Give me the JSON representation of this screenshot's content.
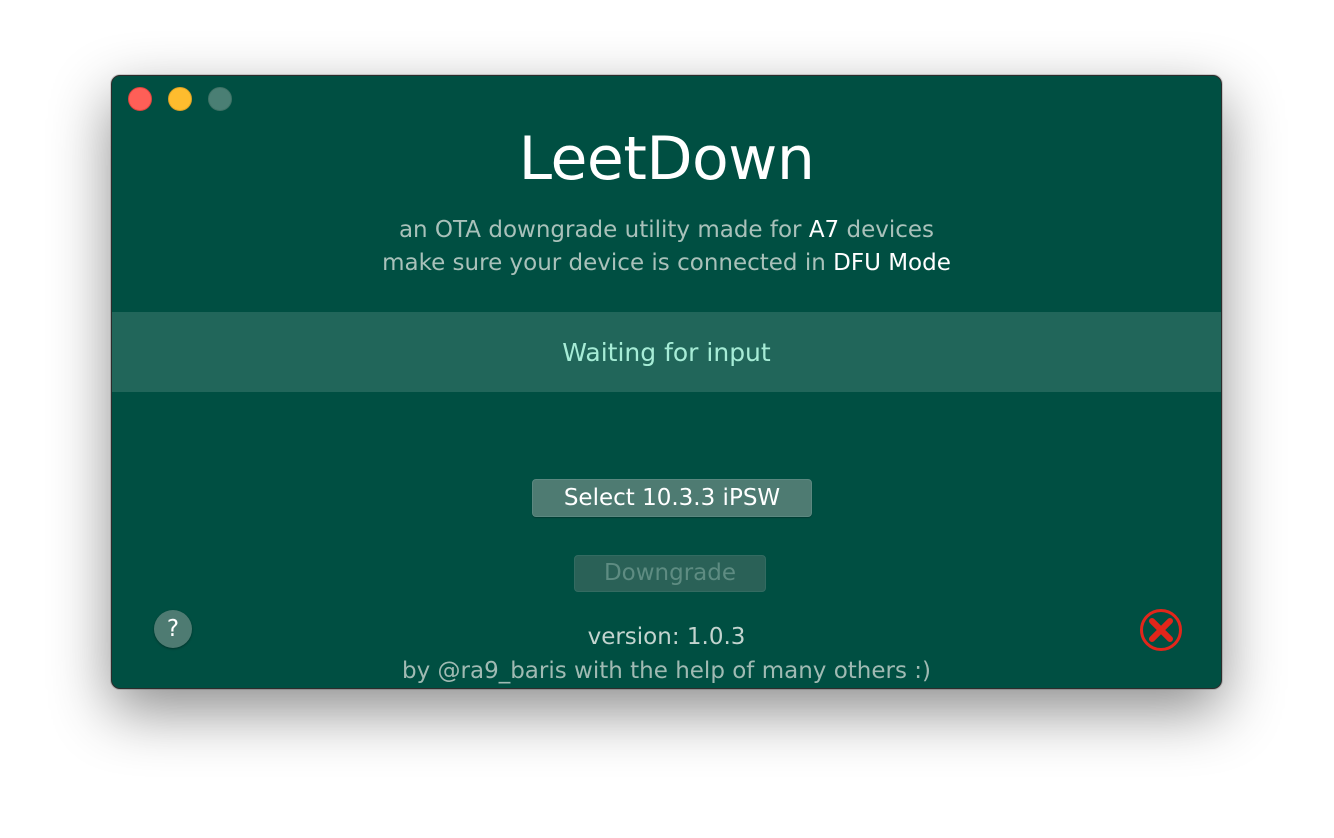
{
  "window": {
    "traffic_lights": [
      "close",
      "minimize",
      "zoom"
    ]
  },
  "app": {
    "title": "LeetDown",
    "subtitle_line1": {
      "prefix": "an OTA downgrade utility made for ",
      "highlight": "A7",
      "suffix": " devices"
    },
    "subtitle_line2": {
      "prefix": "make sure your device is connected in ",
      "highlight": "DFU Mode"
    }
  },
  "status": {
    "text": "Waiting for input"
  },
  "buttons": {
    "select_ipsw": "Select 10.3.3 iPSW",
    "downgrade": "Downgrade",
    "help": "?"
  },
  "footer": {
    "version": "version: 1.0.3",
    "credits": "by @ra9_baris with the help of many others :)"
  },
  "colors": {
    "background": "#004f42",
    "status_band": "#21665a",
    "status_text": "#a6ecd6",
    "close_icon": "#e2261b"
  },
  "icons": {
    "help": "question-mark-icon",
    "quit": "red-x-circle-icon"
  }
}
